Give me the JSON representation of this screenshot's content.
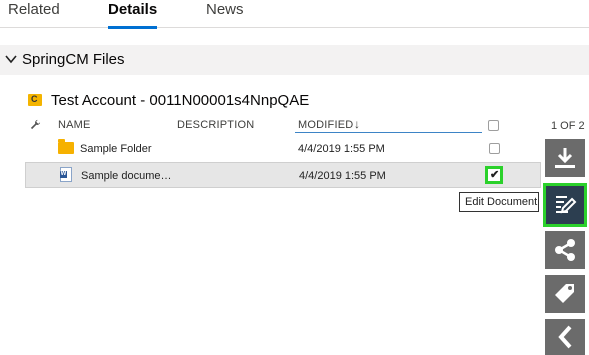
{
  "tabs": [
    {
      "label": "Related"
    },
    {
      "label": "Details"
    },
    {
      "label": "News"
    }
  ],
  "section": {
    "title": "SpringCM Files"
  },
  "folder_path": {
    "title": "Test Account - 0011N00001s4NnpQAE"
  },
  "table": {
    "headers": {
      "name": "NAME",
      "description": "DESCRIPTION",
      "modified": "MODIFIED",
      "sort_glyph": "↓"
    },
    "rows": [
      {
        "name": "Sample Folder",
        "description": "",
        "modified": "4/4/2019 1:55 PM",
        "type": "folder",
        "checked": false
      },
      {
        "name": "Sample docume…",
        "description": "",
        "modified": "4/4/2019 1:55 PM",
        "type": "word-document",
        "checked": true
      }
    ]
  },
  "pager": {
    "text": "1 OF 2"
  },
  "tooltip": {
    "text": "Edit Document"
  },
  "actions": [
    {
      "icon": "download-icon"
    },
    {
      "icon": "edit-document-icon"
    },
    {
      "icon": "share-icon"
    },
    {
      "icon": "tag-icon"
    },
    {
      "icon": "chevron-left-icon"
    }
  ],
  "colors": {
    "accent": "#0070d2",
    "highlight": "#2bd12b",
    "action_bg": "#6b6b6b",
    "action_active_bg": "#2c3e50",
    "folder": "#f6b100"
  }
}
